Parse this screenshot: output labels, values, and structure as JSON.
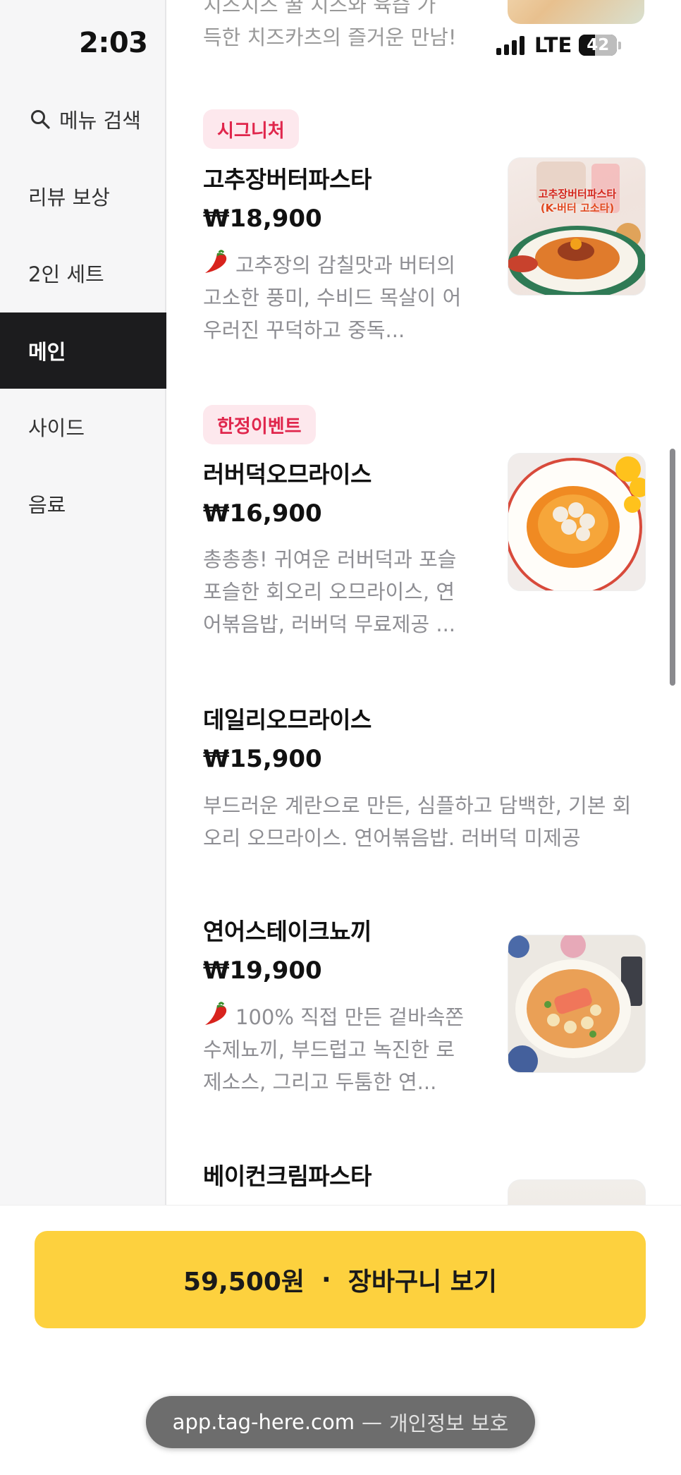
{
  "status_bar": {
    "time": "2:03",
    "network": "LTE",
    "battery": "42",
    "battery_level": 0.42
  },
  "sidebar": {
    "search_label": "메뉴 검색",
    "items": [
      {
        "label": "리뷰 보상",
        "active": false
      },
      {
        "label": "2인 세트",
        "active": false
      },
      {
        "label": "메인",
        "active": true
      },
      {
        "label": "사이드",
        "active": false
      },
      {
        "label": "음료",
        "active": false
      }
    ]
  },
  "menu": {
    "top_fragment": {
      "line1": "치즈치즈 꿀 치즈와 육즙 가",
      "line2": "득한 치즈카츠의 즐거운 만남!"
    },
    "items": [
      {
        "badge": "시그니처",
        "name": "고추장버터파스타",
        "price": "₩18,900",
        "description": "고추장의 감칠맛과 버터의 고소한 풍미, 수비드 목살이 어우러진 꾸덕하고 중독...",
        "spicy": true,
        "thumb_text": "고추장버터파스타",
        "thumb_sub": "(K-버터 고소타)",
        "thumb_icon": "pasta-photo"
      },
      {
        "badge": "한정이벤트",
        "name": "러버덕오므라이스",
        "price": "₩16,900",
        "description": "총총총! 귀여운 러버덕과 포슬포슬한 회오리 오므라이스, 연어볶음밥, 러버덕 무료제공 ...",
        "spicy": false,
        "thumb_icon": "omurice-photo"
      },
      {
        "badge": "",
        "name": "데일리오므라이스",
        "price": "₩15,900",
        "description": "부드러운 계란으로 만든, 심플하고 담백한, 기본 회오리 오므라이스. 연어볶음밥. 러버덕 미제공",
        "spicy": false
      },
      {
        "badge": "",
        "name": "연어스테이크뇨끼",
        "price": "₩19,900",
        "description": "100% 직접 만든 겉바속쫀 수제뇨끼, 부드럽고 녹진한 로제소스, 그리고 두툼한 연...",
        "spicy": true,
        "thumb_icon": "gnocchi-photo"
      },
      {
        "badge": "",
        "name": "베이컨크림파스타",
        "price": "",
        "description": "",
        "spicy": false,
        "thumb_icon": "pasta-photo"
      }
    ]
  },
  "cart": {
    "amount": "59,500원",
    "separator": "·",
    "label": "장바구니 보기"
  },
  "browser": {
    "url": "app.tag-here.com",
    "separator": "—",
    "note": "개인정보 보호"
  },
  "colors": {
    "accent_yellow": "#fdd13e",
    "badge_red": "#e0264c",
    "badge_bg": "#fde8ed",
    "active_nav": "#1c1c1e"
  }
}
